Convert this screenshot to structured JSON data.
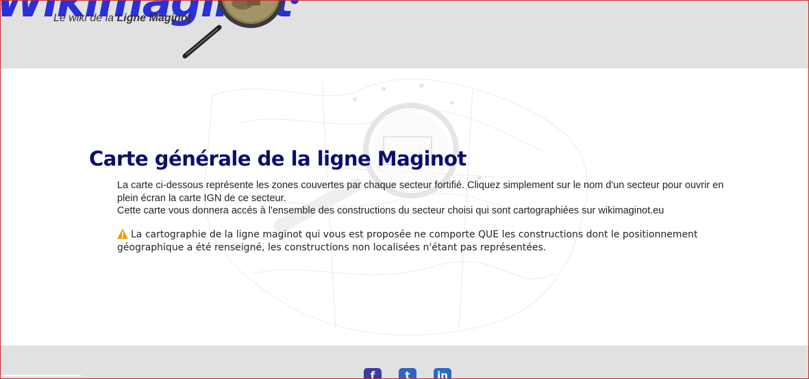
{
  "header": {
    "logo_text": "Wikimaginot",
    "tagline_prefix": "Le wiki de la ",
    "tagline_bold": "Ligne Maginot"
  },
  "main": {
    "title": "Carte générale de la ligne Maginot",
    "intro_line1": "La carte ci-dessous représente les zones couvertes par chaque secteur fortifié. Cliquez simplement sur le nom d'un secteur pour ouvrir en plein écran la carte IGN de ce secteur.",
    "intro_line2": "Cette carte vous donnera accés à l'ensemble des constructions du secteur choisi qui sont cartographiées sur wikimaginot.eu",
    "warning_text": "La cartographie de la ligne maginot qui vous est proposée ne comporte QUE les constructions dont le positionnement géographique a été renseigné, les constructions non localisées n'étant pas représentées."
  },
  "footer": {
    "social": [
      {
        "name": "facebook-icon",
        "glyph": "f",
        "color": "#3b3ba0"
      },
      {
        "name": "twitter-icon",
        "glyph": "t",
        "color": "#2f64c6"
      },
      {
        "name": "linkedin-icon",
        "glyph": "in",
        "color": "#2a69c6"
      }
    ]
  },
  "colors": {
    "title": "#0b0e6e",
    "logo": "#2b2fd6",
    "header_bg": "#e1e1e1",
    "warning": "#f29a00"
  }
}
